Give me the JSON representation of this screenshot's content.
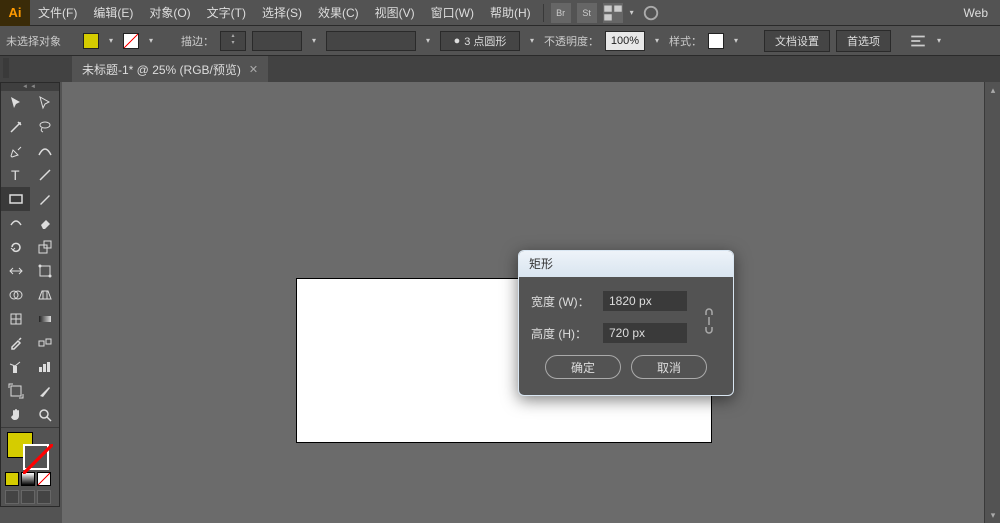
{
  "app": {
    "logo": "Ai"
  },
  "menu": {
    "items": [
      "文件(F)",
      "编辑(E)",
      "对象(O)",
      "文字(T)",
      "选择(S)",
      "效果(C)",
      "视图(V)",
      "窗口(W)",
      "帮助(H)"
    ],
    "right_label": "Web",
    "icons": [
      "Br",
      "St"
    ]
  },
  "options": {
    "no_selection": "未选择对象",
    "stroke_label": "描边：",
    "stroke_style": "3 点圆形",
    "opacity_label": "不透明度：",
    "opacity_value": "100%",
    "style_label": "样式：",
    "btn_doc_setup": "文档设置",
    "btn_prefs": "首选项"
  },
  "document": {
    "tab_title": "未标题-1* @ 25% (RGB/预览)"
  },
  "dialog": {
    "title": "矩形",
    "width_label": "宽度 (W)：",
    "width_value": "1820 px",
    "height_label": "高度 (H)：",
    "height_value": "720 px",
    "ok": "确定",
    "cancel": "取消"
  }
}
